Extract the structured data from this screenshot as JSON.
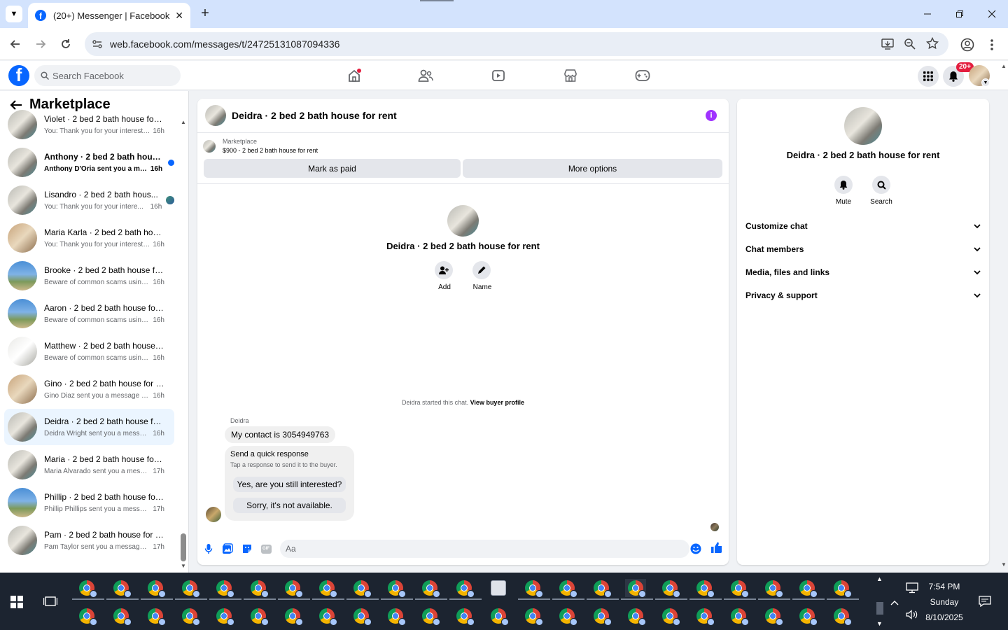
{
  "browser": {
    "tab_title": "(20+) Messenger | Facebook",
    "new_tab": "+",
    "url": "web.facebook.com/messages/t/24725131087094336"
  },
  "fb": {
    "search_placeholder": "Search Facebook",
    "notif_badge": "20+",
    "brand_color": "#0866ff"
  },
  "sidebar": {
    "title": "Marketplace",
    "conversations": [
      {
        "name": "Violet · 2 bed 2 bath house for ...",
        "preview": "You: Thank you for your interest. ...",
        "time": "16h",
        "avatar": "a"
      },
      {
        "name": "Anthony · 2 bed 2 bath house...",
        "preview": "Anthony D'Oria sent you a me...",
        "time": "16h",
        "avatar": "a",
        "unread": true
      },
      {
        "name": "Lisandro · 2 bed 2 bath hous...",
        "preview": "You: Thank you for your intere...",
        "time": "16h",
        "avatar": "a",
        "seen": true
      },
      {
        "name": "Maria Karla · 2 bed 2 bath hous...",
        "preview": "You: Thank you for your interest. ...",
        "time": "16h",
        "avatar": "w"
      },
      {
        "name": "Brooke · 2 bed 2 bath house for...",
        "preview": "Beware of common scams using ...",
        "time": "16h",
        "avatar": "b"
      },
      {
        "name": "Aaron · 2 bed 2 bath house for ...",
        "preview": "Beware of common scams using ...",
        "time": "16h",
        "avatar": "b"
      },
      {
        "name": "Matthew · 2 bed 2 bath house f...",
        "preview": "Beware of common scams using ...",
        "time": "16h",
        "avatar": "g"
      },
      {
        "name": "Gino · 2 bed 2 bath house for r...",
        "preview": "Gino Diaz sent you a message ab...",
        "time": "16h",
        "avatar": "w"
      },
      {
        "name": "Deidra · 2 bed 2 bath house for ...",
        "preview": "Deidra Wright sent you a messag...",
        "time": "16h",
        "avatar": "a",
        "active": true
      },
      {
        "name": "Maria · 2 bed 2 bath house for r...",
        "preview": "Maria Alvarado sent you a messa...",
        "time": "17h",
        "avatar": "a"
      },
      {
        "name": "Phillip · 2 bed 2 bath house for ...",
        "preview": "Phillip Phillips sent you a messag...",
        "time": "17h",
        "avatar": "b"
      },
      {
        "name": "Pam · 2 bed 2 bath house for rent",
        "preview": "Pam Taylor sent you a message a...",
        "time": "17h",
        "avatar": "a"
      }
    ]
  },
  "chat": {
    "title": "Deidra · 2 bed 2 bath house for rent",
    "marketplace_label": "Marketplace",
    "listing": "$900 - 2 bed 2 bath house for rent",
    "mark_paid": "Mark as paid",
    "more_options": "More options",
    "center_name": "Deidra · 2 bed 2 bath house for rent",
    "add_label": "Add",
    "name_label": "Name",
    "started_text": "Deidra started this chat.",
    "view_profile": "View buyer profile",
    "sender": "Deidra",
    "message": "My contact is 3054949763",
    "quick_title": "Send a quick response",
    "quick_sub": "Tap a response to send it to the buyer.",
    "quick_1": "Yes, are you still interested?",
    "quick_2": "Sorry, it's not available.",
    "composer_placeholder": "Aa",
    "gif_label": "GIF"
  },
  "details": {
    "title": "Deidra · 2 bed 2 bath house for rent",
    "mute": "Mute",
    "search": "Search",
    "sections": [
      "Customize chat",
      "Chat members",
      "Media, files and links",
      "Privacy & support"
    ]
  },
  "taskbar": {
    "time": "7:54 PM",
    "day": "Sunday",
    "date": "8/10/2025"
  }
}
